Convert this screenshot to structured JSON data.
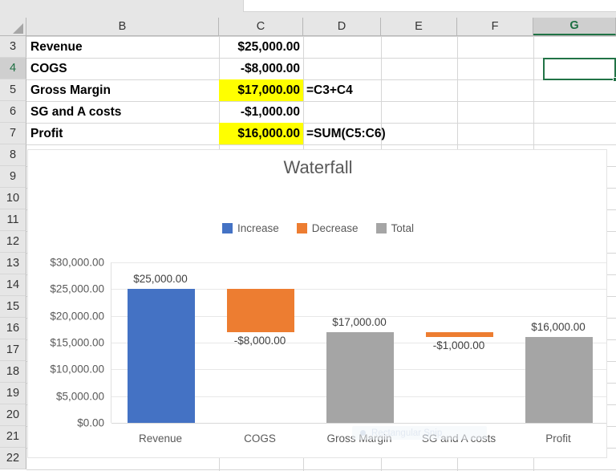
{
  "spreadsheet": {
    "column_headers": [
      "B",
      "C",
      "D",
      "E",
      "F",
      "G"
    ],
    "selected_column": "G",
    "selected_cell": "G4",
    "row_numbers": [
      "3",
      "4",
      "5",
      "6",
      "7",
      "8",
      "9",
      "10",
      "11",
      "12",
      "13",
      "14",
      "15",
      "16",
      "17",
      "18",
      "19",
      "20",
      "21",
      "22"
    ],
    "active_row": "4",
    "rows": [
      {
        "row": "3",
        "B": "Revenue",
        "C": "$25,000.00",
        "C_highlighted": false,
        "D": ""
      },
      {
        "row": "4",
        "B": "COGS",
        "C": "-$8,000.00",
        "C_highlighted": false,
        "D": ""
      },
      {
        "row": "5",
        "B": "Gross Margin",
        "C": "$17,000.00",
        "C_highlighted": true,
        "D": "=C3+C4"
      },
      {
        "row": "6",
        "B": "SG and A costs",
        "C": "-$1,000.00",
        "C_highlighted": false,
        "D": ""
      },
      {
        "row": "7",
        "B": "Profit",
        "C": "$16,000.00",
        "C_highlighted": true,
        "D": "=SUM(C5:C6)"
      }
    ],
    "highlight_color": "#ffff00",
    "selection_color": "#217346"
  },
  "overlay": {
    "snip_label": "Rectangular Snip"
  },
  "chart_data": {
    "type": "bar",
    "title": "Waterfall",
    "xlabel": "",
    "ylabel": "",
    "ylim": [
      0,
      30000
    ],
    "grid": true,
    "legend_position": "top",
    "categories": [
      "Revenue",
      "COGS",
      "Gross Margin",
      "SG and A costs",
      "Profit"
    ],
    "values": [
      25000,
      -8000,
      17000,
      -1000,
      16000
    ],
    "data_labels": [
      "$25,000.00",
      "-$8,000.00",
      "$17,000.00",
      "-$1,000.00",
      "$16,000.00"
    ],
    "bar_bases": [
      0,
      17000,
      0,
      16000,
      0
    ],
    "bar_tops": [
      25000,
      25000,
      17000,
      17000,
      16000
    ],
    "bar_types": [
      "Increase",
      "Decrease",
      "Total",
      "Decrease",
      "Total"
    ],
    "ytick_labels": [
      "$30,000.00",
      "$25,000.00",
      "$20,000.00",
      "$15,000.00",
      "$10,000.00",
      "$5,000.00",
      "$0.00"
    ],
    "ytick_values": [
      30000,
      25000,
      20000,
      15000,
      10000,
      5000,
      0
    ],
    "legend": [
      {
        "label": "Increase",
        "color": "#4472c4"
      },
      {
        "label": "Decrease",
        "color": "#ed7d31"
      },
      {
        "label": "Total",
        "color": "#a5a5a5"
      }
    ]
  }
}
